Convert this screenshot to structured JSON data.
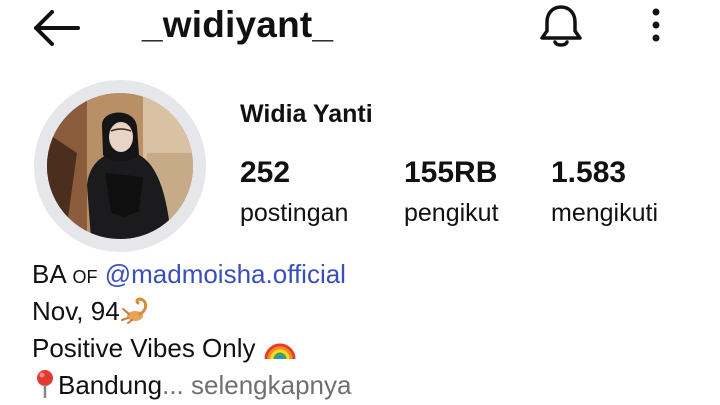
{
  "header": {
    "username": "_widiyant_",
    "back_icon": "arrow-left-icon",
    "notification_icon": "bell-icon",
    "menu_icon": "more-vertical-icon"
  },
  "profile": {
    "full_name": "Widia Yanti",
    "stats": {
      "posts": {
        "value": "252",
        "label": "postingan"
      },
      "followers": {
        "value": "155RB",
        "label": "pengikut"
      },
      "following": {
        "value": "1.583",
        "label": "mengikuti"
      }
    },
    "bio": {
      "line1_prefix": "BA",
      "line1_of": "of",
      "line1_mention": "@madmoisha.official",
      "line2": "Nov, 94",
      "line2_emoji": "scorpion-emoji",
      "line3": "Positive Vibes Only",
      "line3_emoji": "rainbow-emoji",
      "line4_emoji": "pin-emoji",
      "line4": "Bandung",
      "line4_ellipsis": "...",
      "more_link": "selengkapnya"
    }
  },
  "colors": {
    "text": "#111111",
    "mention": "#3b4fb8",
    "muted": "#707070",
    "avatar_ring": "#e6e7ea"
  }
}
